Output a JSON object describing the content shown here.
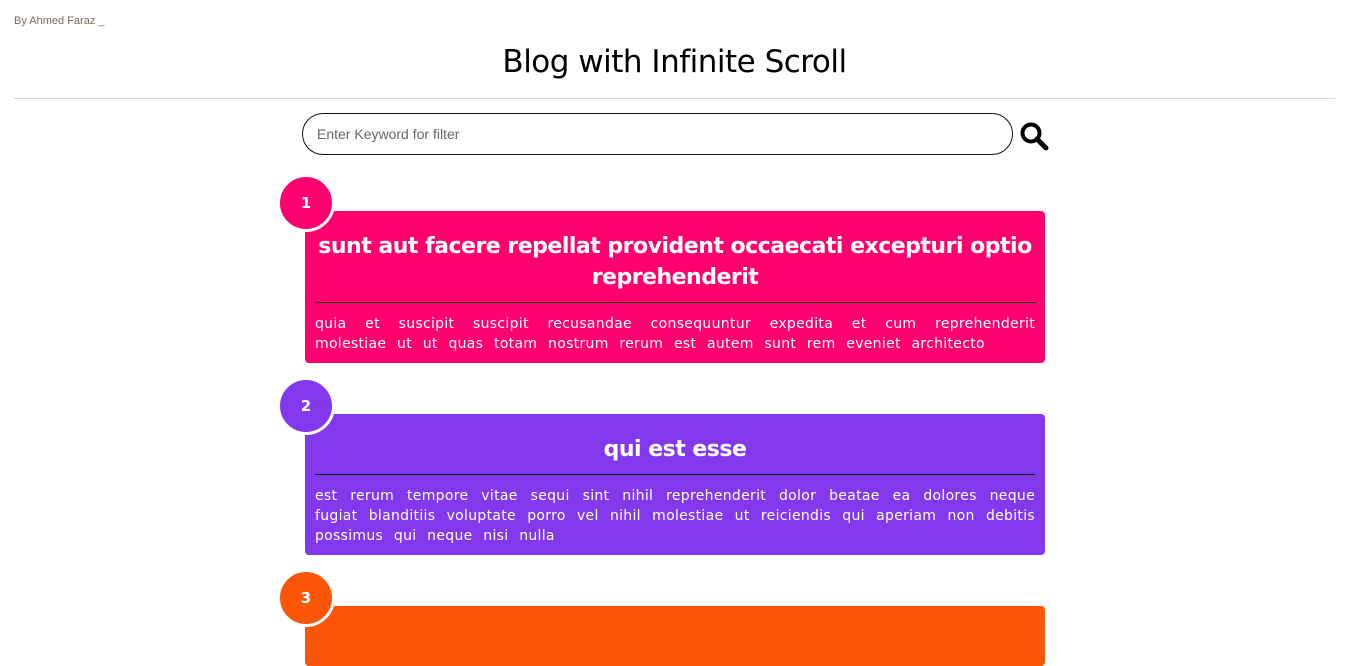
{
  "author": "By Ahmed Faraz _",
  "title": "Blog with Infinite Scroll",
  "search": {
    "placeholder": "Enter Keyword for filter",
    "icon": "search-icon"
  },
  "colors": {
    "post1": "#FF006E",
    "post2": "#8338EC",
    "post3": "#FB5607"
  },
  "posts": [
    {
      "number": "1",
      "title": "sunt aut facere repellat provident occaecati excepturi optio reprehenderit",
      "body": "quia et suscipit suscipit recusandae consequuntur expedita et cum reprehenderit molestiae ut ut quas totam nostrum rerum est autem sunt rem eveniet architecto"
    },
    {
      "number": "2",
      "title": "qui est esse",
      "body": "est rerum tempore vitae sequi sint nihil reprehenderit dolor beatae ea dolores neque fugiat blanditiis voluptate porro vel nihil molestiae ut reiciendis qui aperiam non debitis possimus qui neque nisi nulla"
    },
    {
      "number": "3"
    }
  ]
}
